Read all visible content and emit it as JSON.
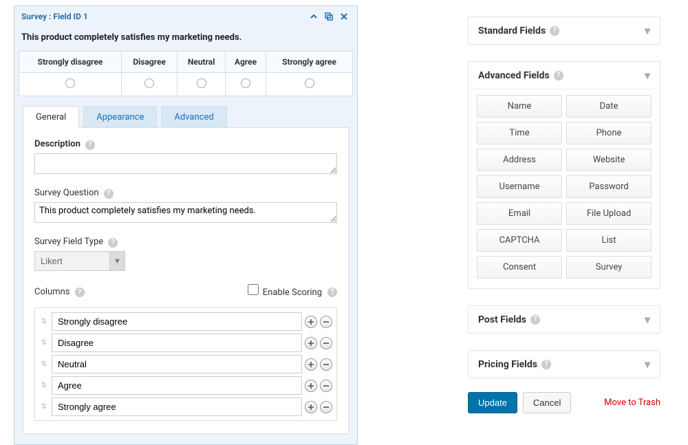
{
  "editor": {
    "header_title": "Survey : Field ID 1",
    "question": "This product completely satisfies my marketing needs.",
    "likert_options": [
      "Strongly disagree",
      "Disagree",
      "Neutral",
      "Agree",
      "Strongly agree"
    ],
    "tabs": [
      {
        "id": "general",
        "label": "General"
      },
      {
        "id": "appearance",
        "label": "Appearance"
      },
      {
        "id": "advanced",
        "label": "Advanced"
      }
    ],
    "active_tab": "general",
    "general": {
      "description_label": "Description",
      "description_value": "",
      "survey_question_label": "Survey Question",
      "survey_question_value": "This product completely satisfies my marketing needs.",
      "field_type_label": "Survey Field Type",
      "field_type_selected": "Likert",
      "columns_label": "Columns",
      "enable_scoring_label": "Enable Scoring",
      "enable_scoring_checked": false,
      "column_values": [
        "Strongly disagree",
        "Disagree",
        "Neutral",
        "Agree",
        "Strongly agree"
      ]
    }
  },
  "sidebar": {
    "panels": {
      "standard": {
        "title": "Standard Fields",
        "open": false
      },
      "advanced": {
        "title": "Advanced Fields",
        "open": true,
        "fields": [
          "Name",
          "Date",
          "Time",
          "Phone",
          "Address",
          "Website",
          "Username",
          "Password",
          "Email",
          "File Upload",
          "CAPTCHA",
          "List",
          "Consent",
          "Survey"
        ]
      },
      "post": {
        "title": "Post Fields",
        "open": false
      },
      "pricing": {
        "title": "Pricing Fields",
        "open": false
      }
    },
    "update_label": "Update",
    "cancel_label": "Cancel",
    "trash_label": "Move to Trash"
  }
}
